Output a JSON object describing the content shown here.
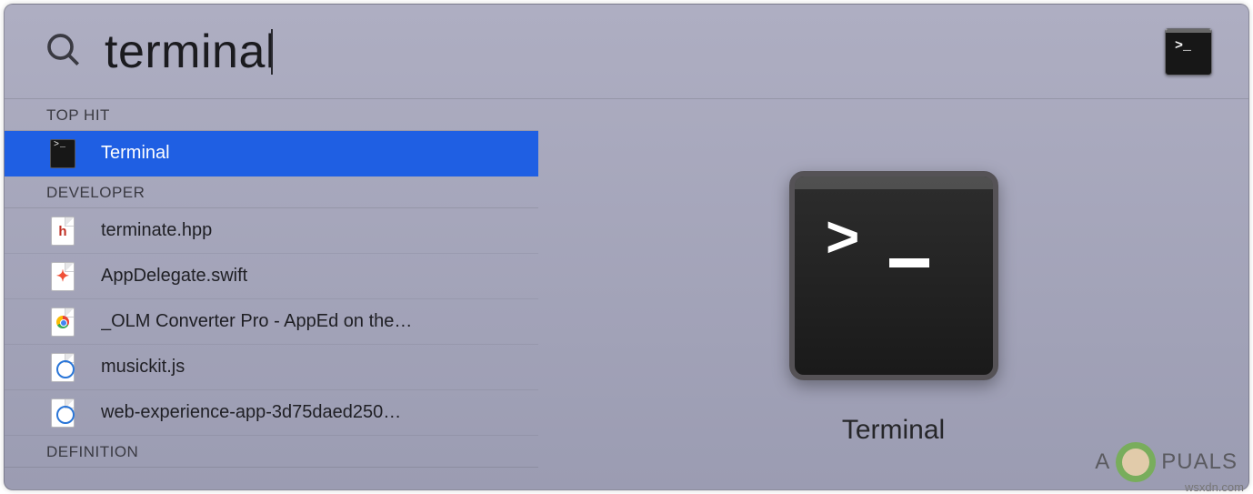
{
  "search": {
    "query": "terminal"
  },
  "header_icon": {
    "name": "terminal-app-icon"
  },
  "sections": [
    {
      "title": "TOP HIT",
      "items": [
        {
          "icon": "terminal-app-icon",
          "label": "Terminal",
          "selected": true
        }
      ]
    },
    {
      "title": "DEVELOPER",
      "items": [
        {
          "icon": "h-file-icon",
          "label": "terminate.hpp"
        },
        {
          "icon": "swift-file-icon",
          "label": "AppDelegate.swift"
        },
        {
          "icon": "chrome-file-icon",
          "label": "_OLM Converter Pro - AppEd on the…"
        },
        {
          "icon": "js-file-icon",
          "label": "musickit.js"
        },
        {
          "icon": "js-file-icon",
          "label": "web-experience-app-3d75daed250…"
        }
      ]
    },
    {
      "title": "DEFINITION",
      "items": []
    }
  ],
  "preview": {
    "title": "Terminal",
    "icon": "terminal-app-icon"
  },
  "watermark": {
    "brand_left": "A",
    "brand_right": "PUALS"
  },
  "attribution": "wsxdn.com"
}
